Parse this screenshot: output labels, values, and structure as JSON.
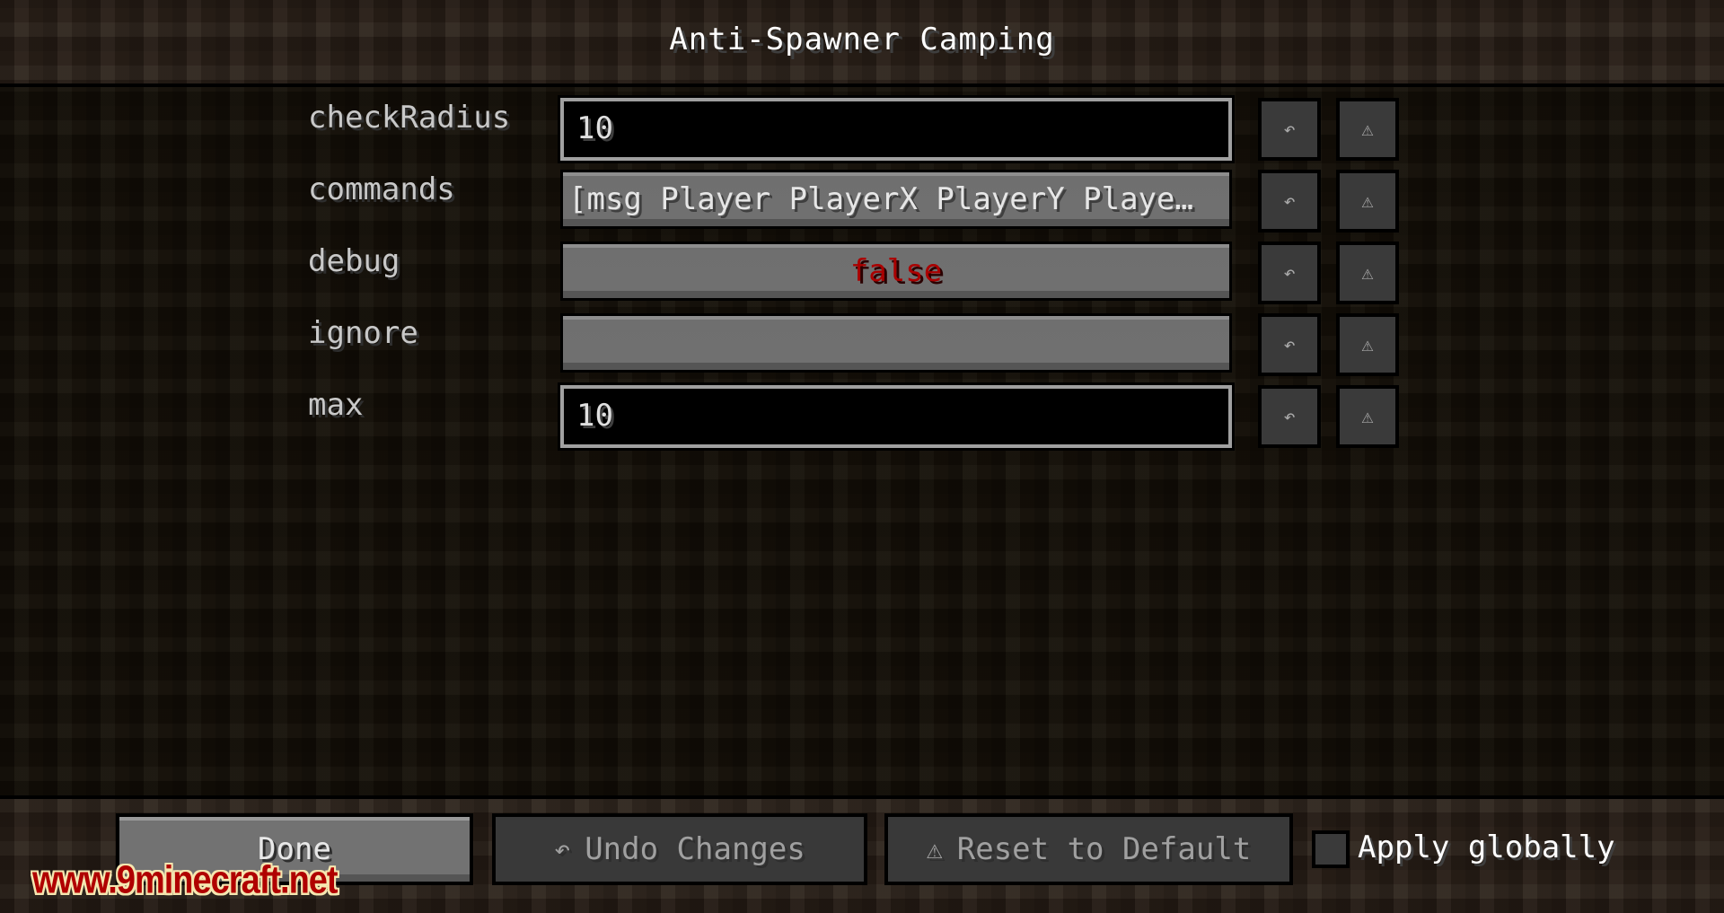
{
  "header": {
    "title": "Anti-Spawner Camping"
  },
  "entries": [
    {
      "label": "checkRadius",
      "type": "text",
      "value": "10"
    },
    {
      "label": "commands",
      "type": "list-button",
      "value": "[msg Player PlayerX PlayerY Playe…"
    },
    {
      "label": "debug",
      "type": "toggle",
      "value": "false"
    },
    {
      "label": "ignore",
      "type": "list-button",
      "value": ""
    },
    {
      "label": "max",
      "type": "text",
      "value": "10"
    }
  ],
  "icons": {
    "undo": "↶",
    "reset": "⚠"
  },
  "footer": {
    "done_label": "Done",
    "undo_label": "Undo Changes",
    "reset_label": "Reset to Default",
    "apply_globally_label": "Apply globally",
    "apply_globally_checked": false
  },
  "watermark": "www.9minecraft.net",
  "colors": {
    "false_text": "#aa0000",
    "title_text": "#ffffff",
    "label_text": "#c8c8c8"
  }
}
